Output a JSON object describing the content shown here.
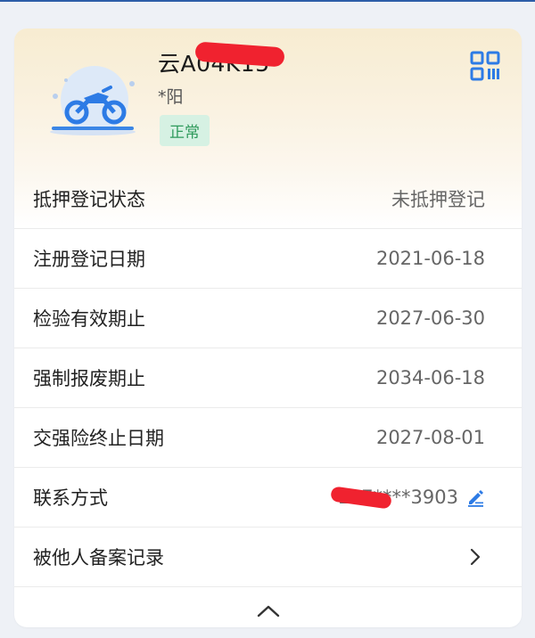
{
  "vehicle": {
    "plate": "云A04K15",
    "owner": "*阳",
    "status": "正常",
    "illustration_icon": "motorcycle-icon",
    "qr_icon": "qr-code-icon"
  },
  "details": [
    {
      "label": "抵押登记状态",
      "value": "未抵押登记"
    },
    {
      "label": "注册登记日期",
      "value": "2021-06-18"
    },
    {
      "label": "检验有效期止",
      "value": "2027-06-30"
    },
    {
      "label": "强制报废期止",
      "value": "2034-06-18"
    },
    {
      "label": "交强险终止日期",
      "value": "2027-08-01"
    },
    {
      "label": "联系方式",
      "value": "147****3903",
      "icon": "edit-icon"
    },
    {
      "label": "被他人备案记录",
      "icon": "chevron-right-icon"
    }
  ],
  "footer": {
    "icon": "chevron-up-icon"
  },
  "colors": {
    "accent": "#2d7be5",
    "status_bg": "#d6f1e3",
    "status_text": "#2f9a5c",
    "redaction": "#f0222f"
  }
}
